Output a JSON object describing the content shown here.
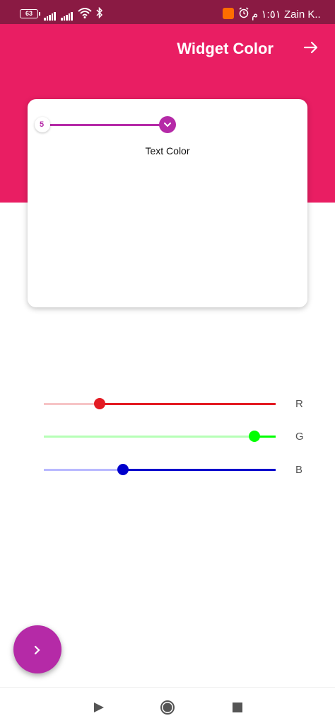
{
  "status_bar": {
    "battery": "63",
    "time_carrier": "١:٥١ م  Zain K.."
  },
  "app_bar": {
    "title": "Widget Color",
    "action_icon": "arrow-forward-icon"
  },
  "card": {
    "knob_text": "5",
    "label": "Text Color",
    "accent": "#b52aa7"
  },
  "sliders": [
    {
      "label": "R",
      "value": 0.24,
      "color": "#e31b23",
      "track_inactive": "#f7c4c6"
    },
    {
      "label": "G",
      "value": 0.91,
      "color": "#00ff00",
      "track_inactive": "#b6ffb6"
    },
    {
      "label": "B",
      "value": 0.34,
      "color": "#0000cc",
      "track_inactive": "#b9b9ff"
    }
  ],
  "fab": {
    "icon": "chevron-right-icon",
    "color": "#b52aa7"
  },
  "nav_bar": {
    "back": "play-back-icon",
    "home": "circle-home-icon",
    "recents": "square-recents-icon"
  }
}
